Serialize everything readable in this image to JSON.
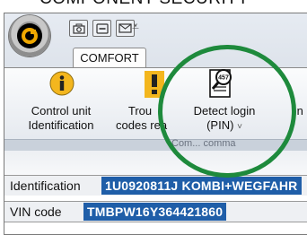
{
  "heading": "COMPONENT SECURITY",
  "tab": {
    "label": "COMFORT"
  },
  "ribbon": {
    "buttons": [
      {
        "line1": "Control unit",
        "line2": "Identification",
        "icon": "info-icon"
      },
      {
        "line1": "Trou",
        "line2": "codes rea",
        "icon": "warning-icon"
      },
      {
        "line1": "Detect login",
        "line2": "(PIN)",
        "dropdown": "˅",
        "icon": "pin-document-icon",
        "icon_text": "457"
      },
      {
        "line1": "In",
        "line2": "",
        "icon": ""
      }
    ],
    "group_label": "Com... comma"
  },
  "fields": {
    "identification": {
      "label": "Identification",
      "value": "1U0920811J  KOMBI+WEGFAHR"
    },
    "vin": {
      "label": "VIN code",
      "value": "TMBPW16Y364421860"
    }
  },
  "colors": {
    "highlight_ring": "#1e8a3c",
    "value_bg": "#1f5ea8",
    "orb": "#f0a800"
  }
}
